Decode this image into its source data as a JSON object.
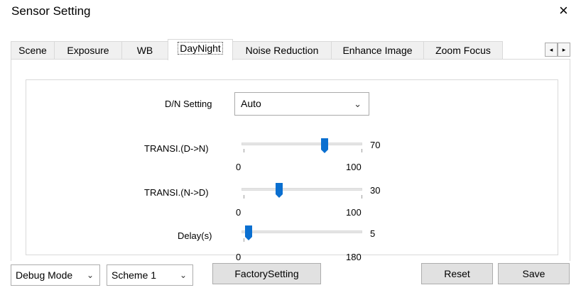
{
  "window": {
    "title": "Sensor Setting",
    "close_icon": "×"
  },
  "tabs": [
    "Scene",
    "Exposure",
    "WB",
    "DayNight",
    "Noise Reduction",
    "Enhance Image",
    "Zoom Focus"
  ],
  "active_tab": "DayNight",
  "scroll": {
    "left": "◂",
    "right": "▸"
  },
  "daynight": {
    "dn_setting_label": "D/N Setting",
    "dn_setting_value": "Auto",
    "sliders": [
      {
        "label": "TRANSI.(D->N)",
        "value": "70",
        "min": "0",
        "max": "100"
      },
      {
        "label": "TRANSI.(N->D)",
        "value": "30",
        "min": "0",
        "max": "100"
      },
      {
        "label": "Delay(s)",
        "value": "5",
        "min": "0",
        "max": "180"
      }
    ]
  },
  "footer": {
    "debug_mode": "Debug Mode",
    "scheme": "Scheme 1",
    "factory_setting": "FactorySetting",
    "reset": "Reset",
    "save": "Save"
  },
  "chevron": "⌄"
}
